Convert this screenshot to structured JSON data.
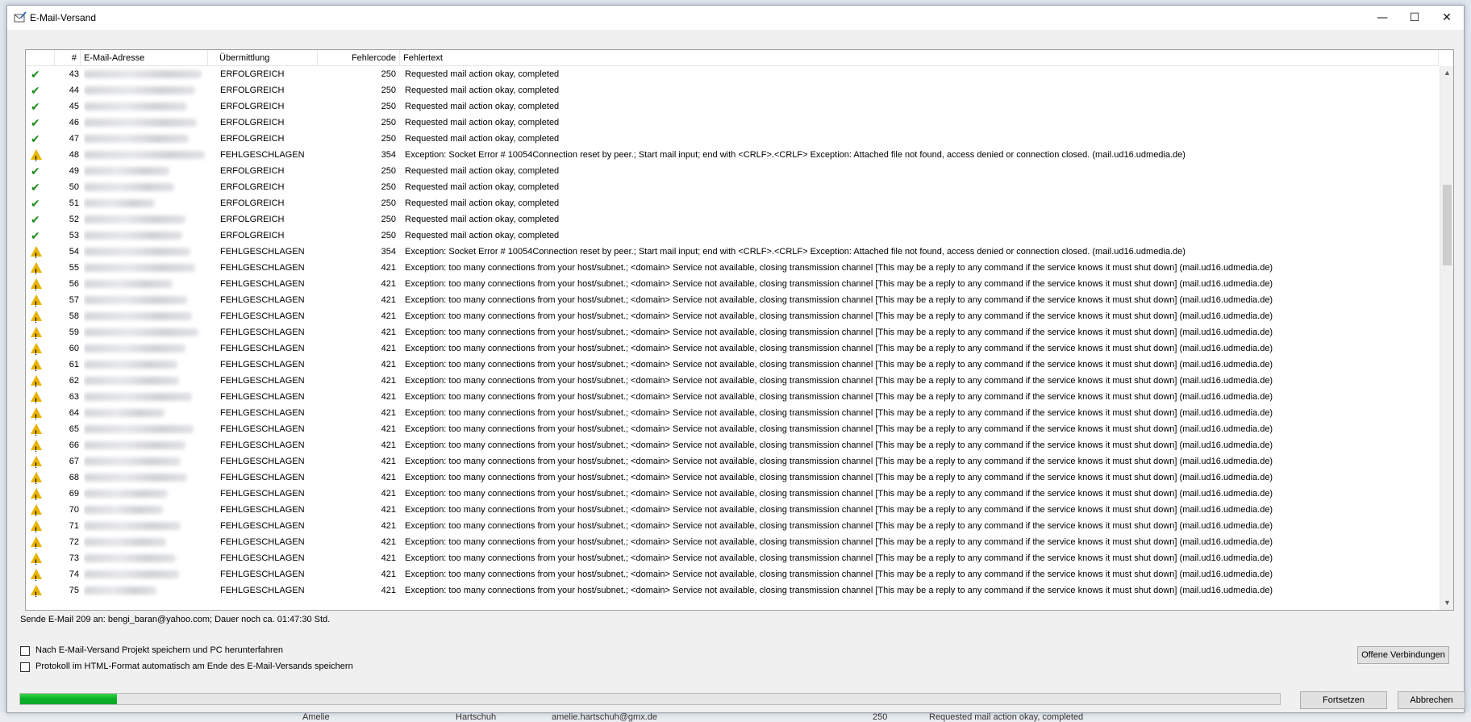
{
  "window": {
    "title": "E-Mail-Versand",
    "minimize": "—",
    "maximize": "☐",
    "close": "✕"
  },
  "grid": {
    "columns": [
      "#",
      "E-Mail-Adresse",
      "Übermittlung",
      "Fehlercode",
      "Fehlertext"
    ],
    "rows": [
      {
        "icon": "check-icon",
        "num": "43",
        "status": "ERFOLGREICH",
        "code": "250",
        "text": "Requested mail action okay, completed"
      },
      {
        "icon": "check-icon",
        "num": "44",
        "status": "ERFOLGREICH",
        "code": "250",
        "text": "Requested mail action okay, completed"
      },
      {
        "icon": "check-icon",
        "num": "45",
        "status": "ERFOLGREICH",
        "code": "250",
        "text": "Requested mail action okay, completed"
      },
      {
        "icon": "check-icon",
        "num": "46",
        "status": "ERFOLGREICH",
        "code": "250",
        "text": "Requested mail action okay, completed"
      },
      {
        "icon": "check-icon",
        "num": "47",
        "status": "ERFOLGREICH",
        "code": "250",
        "text": "Requested mail action okay, completed"
      },
      {
        "icon": "warning-icon",
        "num": "48",
        "status": "FEHLGESCHLAGEN",
        "code": "354",
        "text": "Exception: Socket Error # 10054Connection reset by peer.; Start mail input; end with <CRLF>.<CRLF> Exception: Attached file not found, access denied or connection closed. (mail.ud16.udmedia.de)"
      },
      {
        "icon": "check-icon",
        "num": "49",
        "status": "ERFOLGREICH",
        "code": "250",
        "text": "Requested mail action okay, completed"
      },
      {
        "icon": "check-icon",
        "num": "50",
        "status": "ERFOLGREICH",
        "code": "250",
        "text": "Requested mail action okay, completed"
      },
      {
        "icon": "check-icon",
        "num": "51",
        "status": "ERFOLGREICH",
        "code": "250",
        "text": "Requested mail action okay, completed"
      },
      {
        "icon": "check-icon",
        "num": "52",
        "status": "ERFOLGREICH",
        "code": "250",
        "text": "Requested mail action okay, completed"
      },
      {
        "icon": "check-icon",
        "num": "53",
        "status": "ERFOLGREICH",
        "code": "250",
        "text": "Requested mail action okay, completed"
      },
      {
        "icon": "warning-icon",
        "num": "54",
        "status": "FEHLGESCHLAGEN",
        "code": "354",
        "text": "Exception: Socket Error # 10054Connection reset by peer.; Start mail input; end with <CRLF>.<CRLF> Exception: Attached file not found, access denied or connection closed. (mail.ud16.udmedia.de)"
      },
      {
        "icon": "warning-icon",
        "num": "55",
        "status": "FEHLGESCHLAGEN",
        "code": "421",
        "text": "Exception: too many connections from your host/subnet.; <domain> Service not available, closing transmission channel [This may be a reply to any command if the service knows it must shut down] (mail.ud16.udmedia.de)"
      },
      {
        "icon": "warning-icon",
        "num": "56",
        "status": "FEHLGESCHLAGEN",
        "code": "421",
        "text": "Exception: too many connections from your host/subnet.; <domain> Service not available, closing transmission channel [This may be a reply to any command if the service knows it must shut down] (mail.ud16.udmedia.de)"
      },
      {
        "icon": "warning-icon",
        "num": "57",
        "status": "FEHLGESCHLAGEN",
        "code": "421",
        "text": "Exception: too many connections from your host/subnet.; <domain> Service not available, closing transmission channel [This may be a reply to any command if the service knows it must shut down] (mail.ud16.udmedia.de)"
      },
      {
        "icon": "warning-icon",
        "num": "58",
        "status": "FEHLGESCHLAGEN",
        "code": "421",
        "text": "Exception: too many connections from your host/subnet.; <domain> Service not available, closing transmission channel [This may be a reply to any command if the service knows it must shut down] (mail.ud16.udmedia.de)"
      },
      {
        "icon": "warning-icon",
        "num": "59",
        "status": "FEHLGESCHLAGEN",
        "code": "421",
        "text": "Exception: too many connections from your host/subnet.; <domain> Service not available, closing transmission channel [This may be a reply to any command if the service knows it must shut down] (mail.ud16.udmedia.de)"
      },
      {
        "icon": "warning-icon",
        "num": "60",
        "status": "FEHLGESCHLAGEN",
        "code": "421",
        "text": "Exception: too many connections from your host/subnet.; <domain> Service not available, closing transmission channel [This may be a reply to any command if the service knows it must shut down] (mail.ud16.udmedia.de)"
      },
      {
        "icon": "warning-icon",
        "num": "61",
        "status": "FEHLGESCHLAGEN",
        "code": "421",
        "text": "Exception: too many connections from your host/subnet.; <domain> Service not available, closing transmission channel [This may be a reply to any command if the service knows it must shut down] (mail.ud16.udmedia.de)"
      },
      {
        "icon": "warning-icon",
        "num": "62",
        "status": "FEHLGESCHLAGEN",
        "code": "421",
        "text": "Exception: too many connections from your host/subnet.; <domain> Service not available, closing transmission channel [This may be a reply to any command if the service knows it must shut down] (mail.ud16.udmedia.de)"
      },
      {
        "icon": "warning-icon",
        "num": "63",
        "status": "FEHLGESCHLAGEN",
        "code": "421",
        "text": "Exception: too many connections from your host/subnet.; <domain> Service not available, closing transmission channel [This may be a reply to any command if the service knows it must shut down] (mail.ud16.udmedia.de)"
      },
      {
        "icon": "warning-icon",
        "num": "64",
        "status": "FEHLGESCHLAGEN",
        "code": "421",
        "text": "Exception: too many connections from your host/subnet.; <domain> Service not available, closing transmission channel [This may be a reply to any command if the service knows it must shut down] (mail.ud16.udmedia.de)"
      },
      {
        "icon": "warning-icon",
        "num": "65",
        "status": "FEHLGESCHLAGEN",
        "code": "421",
        "text": "Exception: too many connections from your host/subnet.; <domain> Service not available, closing transmission channel [This may be a reply to any command if the service knows it must shut down] (mail.ud16.udmedia.de)"
      },
      {
        "icon": "warning-icon",
        "num": "66",
        "status": "FEHLGESCHLAGEN",
        "code": "421",
        "text": "Exception: too many connections from your host/subnet.; <domain> Service not available, closing transmission channel [This may be a reply to any command if the service knows it must shut down] (mail.ud16.udmedia.de)"
      },
      {
        "icon": "warning-icon",
        "num": "67",
        "status": "FEHLGESCHLAGEN",
        "code": "421",
        "text": "Exception: too many connections from your host/subnet.; <domain> Service not available, closing transmission channel [This may be a reply to any command if the service knows it must shut down] (mail.ud16.udmedia.de)"
      },
      {
        "icon": "warning-icon",
        "num": "68",
        "status": "FEHLGESCHLAGEN",
        "code": "421",
        "text": "Exception: too many connections from your host/subnet.; <domain> Service not available, closing transmission channel [This may be a reply to any command if the service knows it must shut down] (mail.ud16.udmedia.de)"
      },
      {
        "icon": "warning-icon",
        "num": "69",
        "status": "FEHLGESCHLAGEN",
        "code": "421",
        "text": "Exception: too many connections from your host/subnet.; <domain> Service not available, closing transmission channel [This may be a reply to any command if the service knows it must shut down] (mail.ud16.udmedia.de)"
      },
      {
        "icon": "warning-icon",
        "num": "70",
        "status": "FEHLGESCHLAGEN",
        "code": "421",
        "text": "Exception: too many connections from your host/subnet.; <domain> Service not available, closing transmission channel [This may be a reply to any command if the service knows it must shut down] (mail.ud16.udmedia.de)"
      },
      {
        "icon": "warning-icon",
        "num": "71",
        "status": "FEHLGESCHLAGEN",
        "code": "421",
        "text": "Exception: too many connections from your host/subnet.; <domain> Service not available, closing transmission channel [This may be a reply to any command if the service knows it must shut down] (mail.ud16.udmedia.de)"
      },
      {
        "icon": "warning-icon",
        "num": "72",
        "status": "FEHLGESCHLAGEN",
        "code": "421",
        "text": "Exception: too many connections from your host/subnet.; <domain> Service not available, closing transmission channel [This may be a reply to any command if the service knows it must shut down] (mail.ud16.udmedia.de)"
      },
      {
        "icon": "warning-icon",
        "num": "73",
        "status": "FEHLGESCHLAGEN",
        "code": "421",
        "text": "Exception: too many connections from your host/subnet.; <domain> Service not available, closing transmission channel [This may be a reply to any command if the service knows it must shut down] (mail.ud16.udmedia.de)"
      },
      {
        "icon": "warning-icon",
        "num": "74",
        "status": "FEHLGESCHLAGEN",
        "code": "421",
        "text": "Exception: too many connections from your host/subnet.; <domain> Service not available, closing transmission channel [This may be a reply to any command if the service knows it must shut down] (mail.ud16.udmedia.de)"
      },
      {
        "icon": "warning-icon",
        "num": "75",
        "status": "FEHLGESCHLAGEN",
        "code": "421",
        "text": "Exception: too many connections from your host/subnet.; <domain> Service not available, closing transmission channel [This may be a reply to any command if the service knows it must shut down] (mail.ud16.udmedia.de)"
      }
    ]
  },
  "status_line": "Sende E-Mail 209 an: bengi_baran@yahoo.com; Dauer noch ca. 01:47:30 Std.",
  "options": {
    "shutdown_label": "Nach E-Mail-Versand Projekt speichern und PC herunterfahren",
    "protocol_label": "Protokoll im HTML-Format automatisch am Ende des E-Mail-Versands speichern"
  },
  "buttons": {
    "open_connections": "Offene Verbindungen",
    "continue": "Fortsetzen",
    "cancel": "Abbrechen"
  },
  "progress": {
    "fraction": 0.077
  },
  "background_row": {
    "first_name": "Amelie",
    "last_name": "Hartschuh",
    "email": "amelie.hartschuh@gmx.de",
    "code": "250",
    "text": "Requested mail action okay, completed"
  },
  "colors": {
    "accent_green": "#06b025",
    "success_check": "#1e8c1e",
    "warning": "#e8b400"
  }
}
